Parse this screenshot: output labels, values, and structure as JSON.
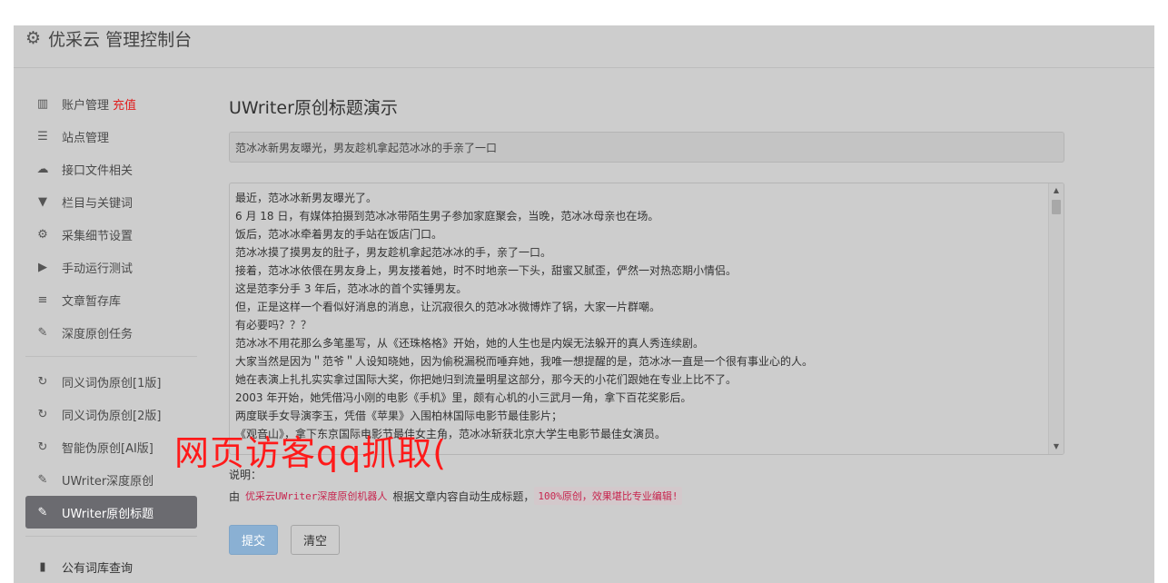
{
  "header": {
    "title": "优采云 管理控制台",
    "icon": "gear-icon"
  },
  "sidebar": {
    "items": [
      {
        "label": "账户管理",
        "extra": "充值",
        "icon": "bar-chart-icon"
      },
      {
        "label": "站点管理",
        "icon": "server-icon"
      },
      {
        "label": "接口文件相关",
        "icon": "cloud-upload-icon"
      },
      {
        "label": "栏目与关键词",
        "icon": "filter-icon"
      },
      {
        "label": "采集细节设置",
        "icon": "cogs-icon"
      },
      {
        "label": "手动运行测试",
        "icon": "play-circle-icon"
      },
      {
        "label": "文章暂存库",
        "icon": "database-icon"
      },
      {
        "label": "深度原创任务",
        "icon": "edit-icon"
      }
    ],
    "items2": [
      {
        "label": "同义词伪原创[1版]",
        "icon": "refresh-icon"
      },
      {
        "label": "同义词伪原创[2版]",
        "icon": "refresh-icon"
      },
      {
        "label": "智能伪原创[AI版]",
        "icon": "refresh-icon"
      },
      {
        "label": "UWriter深度原创",
        "icon": "edit-icon"
      },
      {
        "label": "UWriter原创标题",
        "icon": "edit-icon",
        "active": true
      }
    ],
    "bottom_item": {
      "label": "公有词库查询",
      "icon": "book-icon"
    }
  },
  "main": {
    "page_title": "UWriter原创标题演示",
    "title_value": "范冰冰新男友曝光，男友趁机拿起范冰冰的手亲了一口",
    "content_lines": [
      "最近，范冰冰新男友曝光了。",
      "6 月 18 日，有媒体拍摄到范冰冰带陌生男子参加家庭聚会，当晚，范冰冰母亲也在场。",
      "饭后，范冰冰牵着男友的手站在饭店门口。",
      "范冰冰摸了摸男友的肚子，男友趁机拿起范冰冰的手，亲了一口。",
      "接着，范冰冰依偎在男友身上，男友搂着她，时不时地亲一下头，甜蜜又腻歪，俨然一对热恋期小情侣。",
      "这是范李分手 3 年后，范冰冰的首个实锤男友。",
      "但，正是这样一个看似好消息的消息，让沉寂很久的范冰冰微博炸了锅，大家一片群嘲。",
      "有必要吗？？？",
      "范冰冰不用花那么多笔墨写，从《还珠格格》开始，她的人生也是内娱无法躲开的真人秀连续剧。",
      "大家当然是因为＂范爷＂人设知晓她，因为偷税漏税而唾弃她，我唯一想提醒的是，范冰冰一直是一个很有事业心的人。",
      "她在表演上扎扎实实拿过国际大奖，你把她归到流量明星这部分，那今天的小花们跟她在专业上比不了。",
      "2003 年开始，她凭借冯小刚的电影《手机》里，颇有心机的小三武月一角，拿下百花奖影后。",
      "两度联手女导演李玉，凭借《苹果》入围柏林国际电影节最佳影片；",
      "《观音山》，拿下东京国际电影节最佳女主角，范冰冰斩获北京大学生电影节最佳女演员。"
    ],
    "note_label": "说明：",
    "note_prefix": "由",
    "note_code1": "优采云UWriter深度原创机器人",
    "note_middle": "根据文章内容自动生成标题，",
    "note_code2": "100%原创，效果堪比专业编辑!",
    "submit_label": "提交",
    "clear_label": "清空"
  },
  "watermark": "网页访客qq抓取("
}
